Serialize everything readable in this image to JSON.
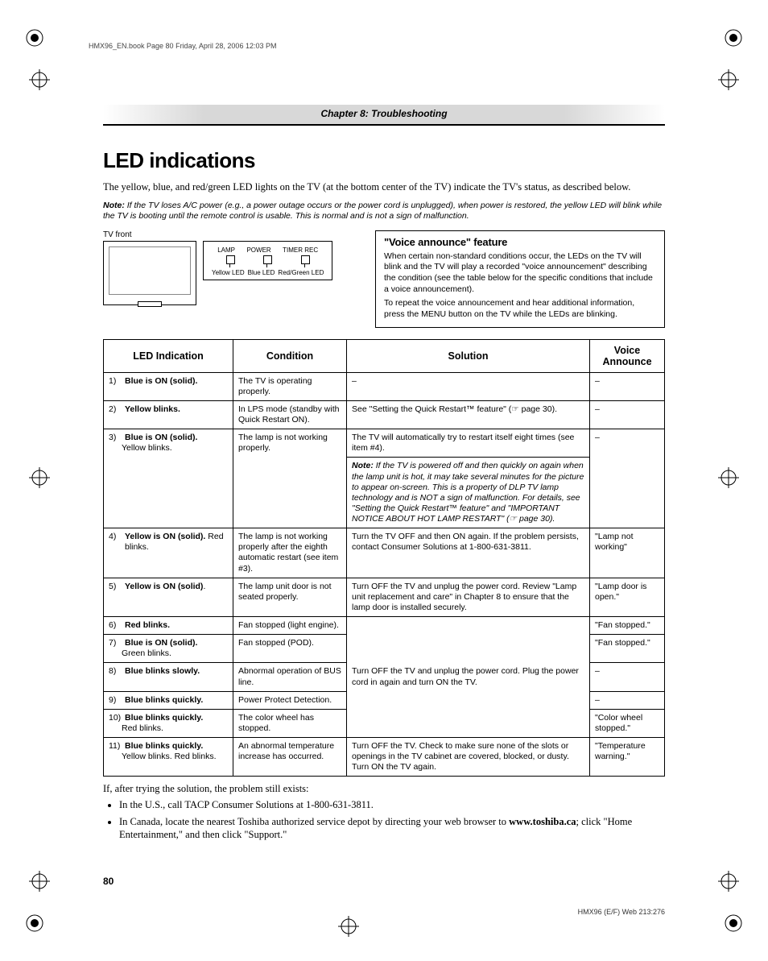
{
  "print_header": "HMX96_EN.book  Page 80  Friday, April 28, 2006  12:03 PM",
  "chapter": "Chapter 8: Troubleshooting",
  "h1": "LED indications",
  "intro": "The yellow, blue, and red/green LED lights on the TV (at the bottom center of the TV) indicate the TV's status, as described below.",
  "note_label": "Note:",
  "top_note": " If the TV loses A/C power (e.g., a power outage occurs or the power cord is unplugged), when power is restored, the yellow LED will blink while the TV is booting until the remote control is usable. This is normal and is not a sign of malfunction.",
  "tv_front": "TV front",
  "led_labels": {
    "lamp": "LAMP",
    "power": "POWER",
    "timer": "TIMER REC",
    "yellow": "Yellow LED",
    "blue": "Blue LED",
    "redgreen": "Red/Green LED"
  },
  "voice": {
    "title": "\"Voice announce\" feature",
    "p1": "When certain non-standard conditions occur, the LEDs on the TV will blink and the TV will play a recorded \"voice announcement\" describing the condition (see the table below for the specific conditions that include a voice announcement).",
    "p2": "To repeat the voice announcement and hear additional information, press the MENU button on the TV while the LEDs are blinking."
  },
  "headers": {
    "led": "LED Indication",
    "cond": "Condition",
    "sol": "Solution",
    "va": "Voice Announce"
  },
  "rows": [
    {
      "idx": "1)",
      "led_bold": "Blue is ON (solid).",
      "led_rest": "",
      "cond": "The TV is operating properly.",
      "sol": "–",
      "va": "–"
    },
    {
      "idx": "2)",
      "led_bold": "Yellow blinks.",
      "led_rest": "",
      "cond": "In LPS mode (standby with Quick Restart ON).",
      "sol": "See \"Setting the Quick Restart™ feature\" (☞ page 30).",
      "va": "–"
    },
    {
      "idx": "3)",
      "led_bold": "Blue is ON (solid).",
      "led_rest": "Yellow blinks.",
      "cond": "The lamp is not working properly.",
      "sol": "The TV will automatically try to restart itself eight times (see item #4).",
      "sol_note": "Note: If the TV is powered off and then quickly on again when the lamp unit is hot, it may take several minutes for the picture to appear on-screen. This is a property of DLP TV lamp technology and is NOT a sign of malfunction. For details, see \"Setting the Quick Restart™ feature\" and \"IMPORTANT NOTICE ABOUT HOT LAMP RESTART\" (☞ page 30).",
      "va": "–"
    },
    {
      "idx": "4)",
      "led_bold": "Yellow is ON (solid).",
      "led_rest": " Red blinks.",
      "cond": "The lamp is not working properly after the eighth automatic restart (see item #3).",
      "sol": "Turn the TV OFF and then ON again. If the problem persists, contact Consumer Solutions at 1-800-631-3811.",
      "va": "\"Lamp not working\""
    },
    {
      "idx": "5)",
      "led_bold": "Yellow is ON (solid)",
      "led_rest": ".",
      "cond": "The lamp unit door is not seated properly.",
      "sol": "Turn OFF the TV and unplug the power cord. Review \"Lamp unit replacement and care\" in Chapter 8 to ensure that the lamp door is installed securely.",
      "va": "\"Lamp door is open.\""
    },
    {
      "idx": "6)",
      "led_bold": "Red blinks.",
      "led_rest": "",
      "cond": "Fan stopped (light engine).",
      "va": "\"Fan stopped.\""
    },
    {
      "idx": "7)",
      "led_bold": "Blue is ON (solid).",
      "led_rest": "Green blinks.",
      "cond": "Fan stopped (POD).",
      "va": "\"Fan stopped.\""
    },
    {
      "idx": "8)",
      "led_bold": "Blue blinks slowly.",
      "led_rest": "",
      "cond": "Abnormal operation of BUS line.",
      "va": "–"
    },
    {
      "idx": "9)",
      "led_bold": "Blue blinks quickly.",
      "led_rest": "",
      "cond": "Power Protect Detection.",
      "va": "–"
    },
    {
      "idx": "10)",
      "led_bold": "Blue blinks quickly.",
      "led_rest": "Red blinks.",
      "cond": "The color wheel has stopped.",
      "va": "\"Color wheel stopped.\""
    },
    {
      "idx": "11)",
      "led_bold": "Blue blinks quickly.",
      "led_rest": "Yellow blinks. Red blinks.",
      "cond": "An abnormal temperature increase has occurred.",
      "sol": "Turn OFF the TV. Check to make sure none of the slots or openings in the TV cabinet are covered, blocked, or dusty. Turn ON the TV again.",
      "va": "\"Temperature warning.\""
    }
  ],
  "shared_sol_6to10": "Turn OFF the TV and unplug the power cord. Plug the power cord in again and turn ON the TV.",
  "after": "If, after trying the solution, the problem still exists:",
  "bullets": [
    "In the U.S., call TACP Consumer Solutions at 1-800-631-3811.",
    "In Canada, locate the nearest Toshiba authorized service depot by directing your web browser to "
  ],
  "toshiba_url": "www.toshiba.ca",
  "bullet2_tail": "; click \"Home Entertainment,\" and then click \"Support.\"",
  "page_num": "80",
  "footer": "HMX96 (E/F) Web 213:276"
}
